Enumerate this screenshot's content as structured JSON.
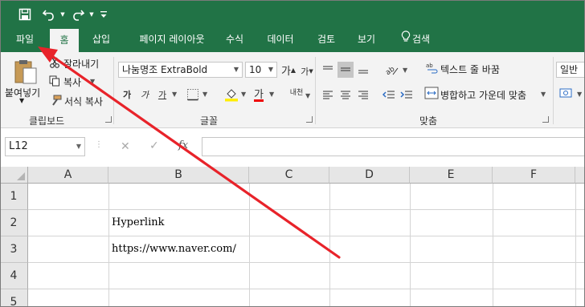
{
  "quick_access": {
    "save_icon": "save-icon",
    "undo_icon": "undo-icon",
    "redo_icon": "redo-icon",
    "customize_icon": "customize-qat-icon"
  },
  "tabs": [
    {
      "label": "파일"
    },
    {
      "label": "홈"
    },
    {
      "label": "삽입"
    },
    {
      "label": "페이지 레이아웃"
    },
    {
      "label": "수식"
    },
    {
      "label": "데이터"
    },
    {
      "label": "검토"
    },
    {
      "label": "보기"
    },
    {
      "label": "검색"
    }
  ],
  "ribbon": {
    "clipboard": {
      "paste": "붙여넣기",
      "cut": "잘라내기",
      "copy": "복사",
      "format_painter": "서식 복사",
      "group": "클립보드"
    },
    "font": {
      "font_name": "나눔명조 ExtraBold",
      "font_size": "10",
      "grow": "가",
      "shrink": "가",
      "bold": "가",
      "italic": "가",
      "underline": "가",
      "font_color": "가",
      "phonetic": "내천",
      "group": "글꼴"
    },
    "alignment": {
      "wrap_text": "텍스트 줄 바꿈",
      "merge_center": "병합하고 가운데 맞춤",
      "group": "맞춤"
    },
    "number": {
      "format": "일반"
    }
  },
  "formula_bar": {
    "name_box": "L12",
    "cancel": "✕",
    "enter": "✓",
    "fx": "fx",
    "value": ""
  },
  "sheet": {
    "columns": [
      "A",
      "B",
      "C",
      "D",
      "E",
      "F"
    ],
    "rows": [
      "1",
      "2",
      "3",
      "4",
      "5"
    ],
    "cells": {
      "B2": "Hyperlink",
      "B3": "https://www.naver.com/"
    }
  },
  "annotation": {
    "color": "#e8232a",
    "points_to": "파일"
  },
  "colors": {
    "excel_green": "#217346",
    "ribbon_bg": "#f3f3f3",
    "header_bg": "#e6e6e6"
  }
}
